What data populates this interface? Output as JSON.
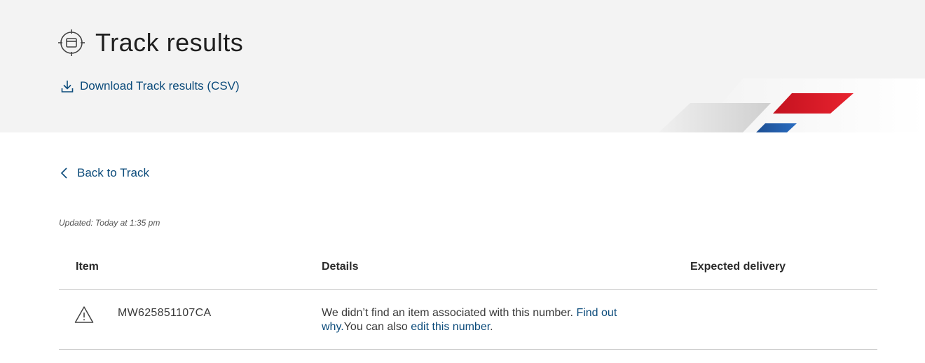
{
  "header": {
    "title": "Track results",
    "title_icon": "target-box-icon",
    "download_link": "Download Track results (CSV)",
    "download_icon": "download-icon",
    "brand_colors": {
      "gray": "#d8d8d8",
      "red": "#d71f2b",
      "blue": "#1f5fa8"
    }
  },
  "nav": {
    "back_link": "Back to Track",
    "back_icon": "chevron-left-icon"
  },
  "status": {
    "updated": "Updated: Today at 1:35 pm"
  },
  "table": {
    "columns": [
      "Item",
      "Details",
      "Expected delivery"
    ],
    "rows": [
      {
        "status_icon": "warning-icon",
        "tracking_number": "MW625851107CA",
        "details_text": "We didn’t find an item associated with this number.",
        "find_out_link": "Find out why.",
        "you_can_also": "You can also",
        "edit_link": "edit this number",
        "trailing": ".",
        "expected_delivery": ""
      }
    ]
  },
  "colors": {
    "link": "#0a4a7a",
    "header_bg": "#f3f3f3",
    "divider": "#c9c9c9"
  }
}
